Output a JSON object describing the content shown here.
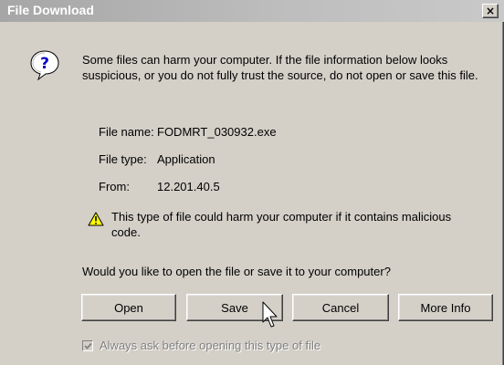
{
  "window": {
    "title": "File Download",
    "close_symbol": "×"
  },
  "message": {
    "icon": "question-icon",
    "text": "Some files can harm your computer. If the file information below looks suspicious, or you do not fully trust the source, do not open or save this file."
  },
  "file_info": {
    "name_label": "File name:",
    "name_value": "FODMRT_030932.exe",
    "type_label": "File type:",
    "type_value": "Application",
    "from_label": "From:",
    "from_value": "12.201.40.5"
  },
  "caution": {
    "icon": "warning-icon",
    "text": "This type of file could harm your computer if it contains malicious code."
  },
  "prompt": {
    "question": "Would you like to open the file or save it to your computer?"
  },
  "buttons": {
    "open": "Open",
    "save": "Save",
    "cancel": "Cancel",
    "more_info": "More Info"
  },
  "checkbox": {
    "label": "Always ask before opening this type of file",
    "checked": true,
    "disabled": true
  },
  "colors": {
    "face": "#d4d0c8",
    "title_inactive": "#a6a6a6",
    "disabled_text": "#808080"
  }
}
